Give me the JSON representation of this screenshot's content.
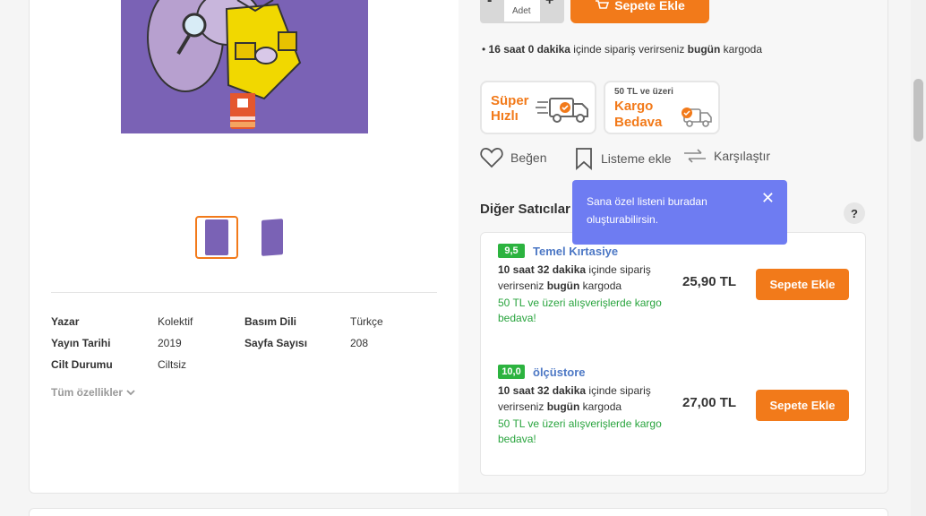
{
  "product": {
    "thumbnails": [
      "thumbnail-1",
      "thumbnail-2"
    ],
    "attributes": [
      {
        "label": "Yazar",
        "value": "Kolektif"
      },
      {
        "label": "Basım Dili",
        "value": "Türkçe"
      },
      {
        "label": "Yayın Tarihi",
        "value": "2019"
      },
      {
        "label": "Sayfa Sayısı",
        "value": "208"
      },
      {
        "label": "Cilt Durumu",
        "value": "Ciltsiz"
      }
    ],
    "all_features_label": "Tüm özellikler"
  },
  "purchase": {
    "qty_minus": "-",
    "qty_plus": "+",
    "qty_label": "Adet",
    "add_to_cart": "Sepete Ekle",
    "shipping_note": {
      "time": "16 saat 0 dakika",
      "middle": " içinde sipariş verirseniz ",
      "today": "bugün",
      "end": " kargoda"
    }
  },
  "badges": {
    "fast": {
      "line1": "Süper",
      "line2": "Hızlı"
    },
    "free": {
      "small": "50 TL ve üzeri",
      "line1": "Kargo",
      "line2": "Bedava"
    }
  },
  "actions": {
    "like": "Beğen",
    "add_to_list": "Listeme ekle",
    "compare": "Karşılaştır"
  },
  "tooltip": {
    "text": "Sana özel listeni buradan oluşturabilirsin."
  },
  "sellers": {
    "title": "Diğer Satıcılar",
    "help": "?",
    "items": [
      {
        "rating": "9,5",
        "name": "Temel Kırtasiye",
        "time": "10 saat 32 dakika",
        "ship_rest1": " içinde sipariş verirseniz ",
        "today": "bugün",
        "ship_rest2": " kargoda",
        "free_note": "50 TL ve üzeri alışverişlerde kargo bedava!",
        "price": "25,90 TL",
        "button": "Sepete Ekle"
      },
      {
        "rating": "10,0",
        "name": "ölçüstore",
        "time": "10 saat 32 dakika",
        "ship_rest1": " içinde sipariş verirseniz ",
        "today": "bugün",
        "ship_rest2": " kargoda",
        "free_note": "50 TL ve üzeri alışverişlerde kargo bedava!",
        "price": "27,00 TL",
        "button": "Sepete Ekle"
      }
    ]
  },
  "colors": {
    "brand_orange": "#f27a1a",
    "tooltip_bg": "#6e7cf2",
    "rating_green": "#2cb33f",
    "seller_link": "#4d78c5"
  }
}
